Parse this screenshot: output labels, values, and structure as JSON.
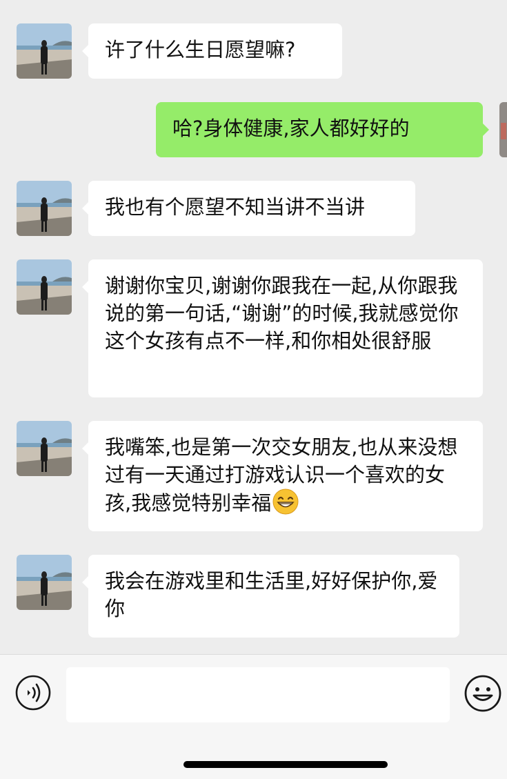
{
  "messages": [
    {
      "side": "left",
      "text": "许了什么生日愿望嘛?"
    },
    {
      "side": "right",
      "text": "哈?身体健康,家人都好好的"
    },
    {
      "side": "left",
      "text": "我也有个愿望不知当讲不当讲"
    },
    {
      "side": "left",
      "text": "谢谢你宝贝,谢谢你跟我在一起,从你跟我说的第一句话,“谢谢”的时候,我就感觉你这个女孩有点不一样,和你相处很舒服"
    },
    {
      "side": "left",
      "text": "我嘴笨,也是第一次交女朋友,也从来没想过有一天通过打游戏认识一个喜欢的女孩,我感觉特别幸福",
      "trailing_emoji": "grinning-face"
    },
    {
      "side": "left",
      "text": "我会在游戏里和生活里,好好保护你,爱你"
    }
  ],
  "input": {
    "value": "",
    "placeholder": ""
  },
  "icons": {
    "voice": "voice-icon",
    "emoji": "smiley-icon"
  },
  "colors": {
    "background": "#ededed",
    "incoming_bubble": "#ffffff",
    "outgoing_bubble": "#95ec69"
  }
}
